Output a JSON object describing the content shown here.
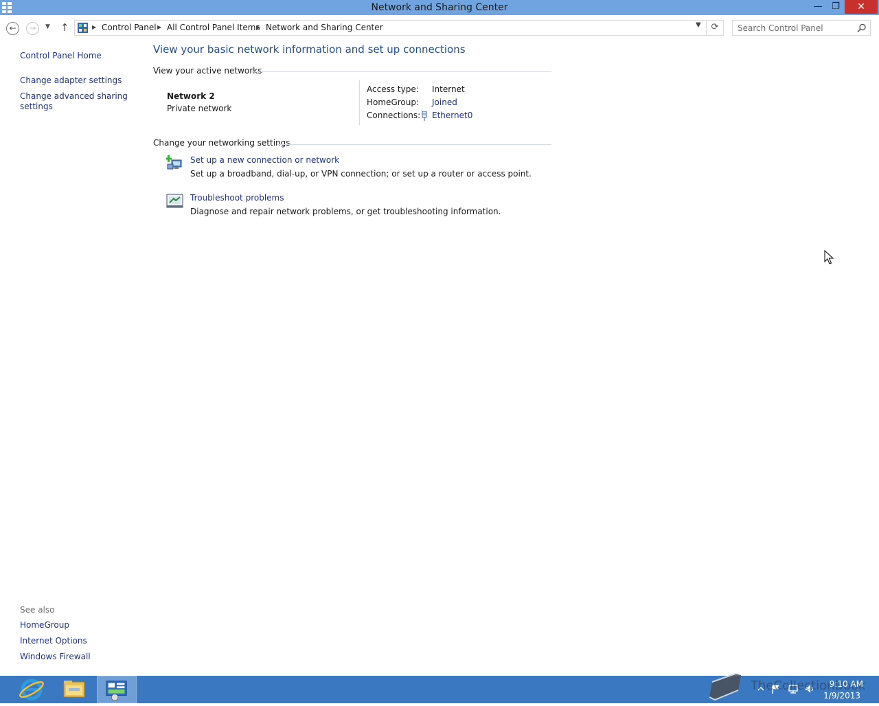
{
  "window": {
    "title": "Network and Sharing Center",
    "controls": {
      "minimize": "—",
      "restore": "❐",
      "close": "✕"
    }
  },
  "address": {
    "breadcrumbs": [
      "Control Panel",
      "All Control Panel Items",
      "Network and Sharing Center"
    ],
    "search_placeholder": "Search Control Panel"
  },
  "sidebar": {
    "links": [
      "Control Panel Home",
      "Change adapter settings",
      "Change advanced sharing settings"
    ],
    "see_also_label": "See also",
    "see_also": [
      "HomeGroup",
      "Internet Options",
      "Windows Firewall"
    ]
  },
  "main": {
    "title": "View your basic network information and set up connections",
    "active_networks_heading": "View your active networks",
    "network": {
      "name": "Network  2",
      "category": "Private network",
      "access_type_label": "Access type:",
      "access_type": "Internet",
      "homegroup_label": "HomeGroup:",
      "homegroup": "Joined",
      "connections_label": "Connections:",
      "connection": "Ethernet0"
    },
    "change_settings_heading": "Change your networking settings",
    "tasks": [
      {
        "link": "Set up a new connection or network",
        "description": "Set up a broadband, dial-up, or VPN connection; or set up a router or access point.",
        "icon": "network-setup-icon"
      },
      {
        "link": "Troubleshoot problems",
        "description": "Diagnose and repair network problems, or get troubleshooting information.",
        "icon": "troubleshoot-icon"
      }
    ]
  },
  "taskbar": {
    "apps": [
      "internet-explorer-icon",
      "file-explorer-icon",
      "control-panel-icon"
    ],
    "watermark": "TheCollectionBook",
    "clock_time": "9:10 AM",
    "clock_date": "1/9/2013"
  },
  "colors": {
    "titlebar": "#6fa4e0",
    "taskbar": "#3a78c2",
    "link": "#1e3287",
    "heading": "#1e4e8c",
    "close": "#c7302c"
  }
}
